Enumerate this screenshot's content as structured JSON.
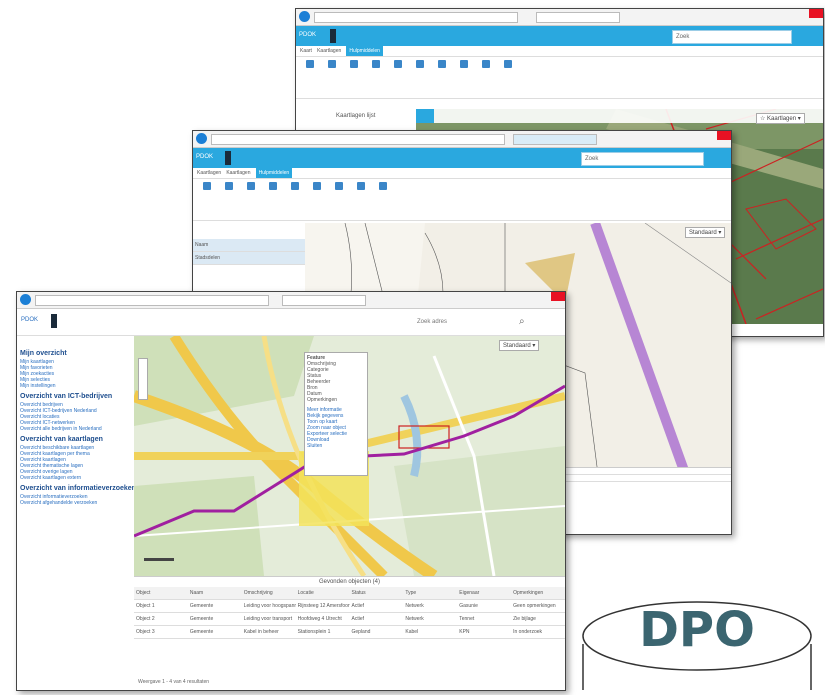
{
  "windows": {
    "back": {
      "brand": "PDOK",
      "search_placeholder": "Zoek",
      "tabs": [
        "Kaart",
        "Kaartlagen",
        "Hulpmiddelen"
      ],
      "legend_btn": "Kaartlagen lijst",
      "bookmark": "☆ Kaartlagen ▾"
    },
    "middle": {
      "brand": "PDOK",
      "search_placeholder": "Zoek",
      "tabs": [
        "Kaartlagen",
        "Kaartlagen",
        "Hulpmiddelen"
      ],
      "panel_row1": "Naam",
      "panel_row2": "Stadsdelen",
      "dropdown": "Standaard ▾"
    },
    "front": {
      "brand": "PDOK",
      "search_text": "Zoek adres",
      "sidebar": {
        "sec1": "Mijn overzicht",
        "sec1_links": [
          "Mijn kaartlagen",
          "Mijn favorieten",
          "Mijn zoekacties",
          "Mijn selecties",
          "Mijn instellingen"
        ],
        "sec2": "Overzicht van ICT-bedrijven",
        "sec2_links": [
          "Overzicht bedrijven",
          "Overzicht ICT-bedrijven Nederland",
          "Overzicht locaties",
          "Overzicht ICT-netwerken",
          "Overzicht alle bedrijven in Nederland"
        ],
        "sec3": "Overzicht van kaartlagen",
        "sec3_links": [
          "Overzicht beschikbare kaartlagen",
          "Overzicht kaartlagen per thema",
          "Overzicht kaartlagen",
          "Overzicht thematische lagen",
          "Overzicht overige lagen",
          "Overzicht kaartlagen extern"
        ],
        "sec4": "Overzicht van informatieverzoeken",
        "sec4_links": [
          "Overzicht informatieverzoeken",
          "Overzicht afgehandelde verzoeken"
        ]
      },
      "map_dropdown": "Standaard ▾",
      "popup_title": "Feature",
      "popup_lines": [
        "Omschrijving",
        "Categorie",
        "Status",
        "Beheerder",
        "Bron",
        "Datum",
        "Opmerkingen"
      ],
      "popup_links": [
        "Meer informatie",
        "Bekijk gegevens",
        "Toon op kaart",
        "Zoom naar object",
        "Exporteer selectie",
        "Download",
        "Sluiten"
      ],
      "table_title": "Gevonden objecten (4)",
      "table_header": [
        "Object",
        "Naam",
        "Omschrijving",
        "Locatie",
        "Status",
        "Type",
        "Eigenaar",
        "Opmerkingen"
      ],
      "table_rows": [
        [
          "Object 1",
          "Gemeente",
          "Leiding voor hoogspanning",
          "Rijnsteeg 12 Amersfoort",
          "Actief",
          "Netwerk",
          "Gasunie",
          "Geen opmerkingen"
        ],
        [
          "Object 2",
          "Gemeente",
          "Leiding voor transport",
          "Hoofdweg 4 Utrecht",
          "Actief",
          "Netwerk",
          "Tennet",
          "Zie bijlage"
        ],
        [
          "Object 3",
          "Gemeente",
          "Kabel in beheer",
          "Stationsplein 1",
          "Gepland",
          "Kabel",
          "KPN",
          "In onderzoek"
        ]
      ],
      "status_bar": "Weergave 1 - 4 van 4 resultaten"
    }
  },
  "logo": {
    "text": "DPO"
  },
  "colors": {
    "blue_bar": "#2aa8df",
    "purple_route": "#a020a0",
    "yellow_area": "#f3e35a",
    "red_outline": "#cc2222",
    "logo_text": "#3b6570"
  }
}
